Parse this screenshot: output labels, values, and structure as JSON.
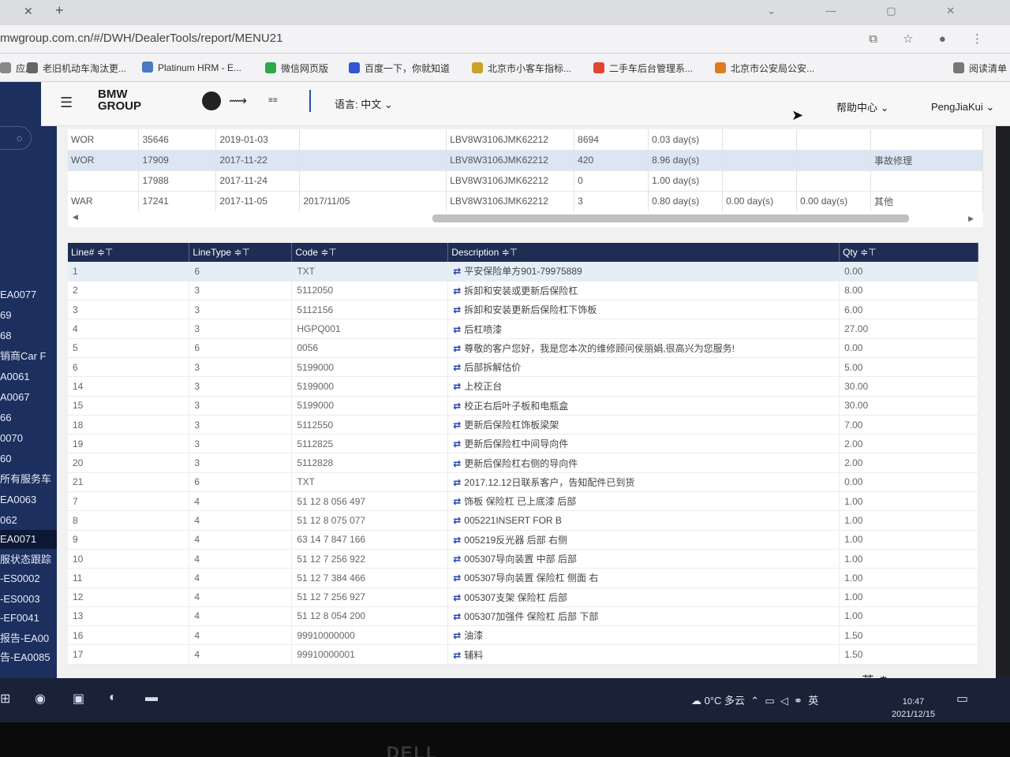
{
  "browser": {
    "url": "mwgroup.com.cn/#/DWH/DealerTools/report/MENU21",
    "bookmarks": [
      "应用",
      "老旧机动车淘汰更...",
      "Platinum HRM - E...",
      "微信网页版",
      "百度一下，你就知道",
      "北京市小客车指标...",
      "二手车后台管理系...",
      "北京市公安局公安...",
      "阅读清单"
    ]
  },
  "header": {
    "logo_line1": "BMW",
    "logo_line2": "GROUP",
    "language": "语言: 中文",
    "help": "帮助中心",
    "user": "PengJiaKui"
  },
  "sidebar": {
    "items": [
      "EA0077",
      "69",
      "68",
      "销商Car F",
      "A0061",
      "A0067",
      "66",
      "0070",
      "60",
      "所有服务车",
      "EA0063",
      "062",
      "EA0071",
      "服状态跟踪",
      "-ES0002",
      "-ES0003",
      "-EF0041",
      "报告-EA00",
      "告-EA0085"
    ],
    "active_index": 12
  },
  "top_table": {
    "rows": [
      [
        "WOR",
        "35646",
        "2019-01-03",
        "",
        "LBV8W3106JMK62212",
        "8694",
        "0.03 day(s)",
        "",
        "",
        ""
      ],
      [
        "WOR",
        "17909",
        "2017-11-22",
        "",
        "LBV8W3106JMK62212",
        "420",
        "8.96 day(s)",
        "",
        "",
        "事故修理"
      ],
      [
        "",
        "17988",
        "2017-11-24",
        "",
        "LBV8W3106JMK62212",
        "0",
        "1.00 day(s)",
        "",
        "",
        ""
      ],
      [
        "WAR",
        "17241",
        "2017-11-05",
        "2017/11/05",
        "LBV8W3106JMK62212",
        "3",
        "0.80 day(s)",
        "0.00 day(s)",
        "0.00 day(s)",
        "其他"
      ]
    ],
    "selected_row": 1
  },
  "lines_table": {
    "columns": [
      "Line# ≑⊤",
      "LineType ≑⊤",
      "Code ≑⊤",
      "Description ≑⊤",
      "Qty ≑⊤"
    ],
    "rows": [
      [
        "1",
        "6",
        "TXT",
        "平安保险单方901-79975889",
        "0.00"
      ],
      [
        "2",
        "3",
        "5112050",
        "拆卸和安装或更新后保险杠",
        "8.00"
      ],
      [
        "3",
        "3",
        "5112156",
        "拆卸和安装更新后保险杠下饰板",
        "6.00"
      ],
      [
        "4",
        "3",
        "HGPQ001",
        "后杠喷漆",
        "27.00"
      ],
      [
        "5",
        "6",
        "0056",
        "尊敬的客户您好，我是您本次的维修顾问侯丽娟,很高兴为您服务!",
        "0.00"
      ],
      [
        "6",
        "3",
        "5199000",
        "后部拆解估价",
        "5.00"
      ],
      [
        "14",
        "3",
        "5199000",
        "上校正台",
        "30.00"
      ],
      [
        "15",
        "3",
        "5199000",
        "校正右后叶子板和电瓶盒",
        "30.00"
      ],
      [
        "18",
        "3",
        "5112550",
        "更新后保险杠饰板梁架",
        "7.00"
      ],
      [
        "19",
        "3",
        "5112825",
        "更新后保险杠中间导向件",
        "2.00"
      ],
      [
        "20",
        "3",
        "5112828",
        "更新后保险杠右侧的导向件",
        "2.00"
      ],
      [
        "21",
        "6",
        "TXT",
        "2017.12.12日联系客户，告知配件已到货",
        "0.00"
      ],
      [
        "7",
        "4",
        "51 12 8 056 497",
        "饰板 保险杠 已上底漆 后部",
        "1.00"
      ],
      [
        "8",
        "4",
        "51 12 8 075 077",
        "005221INSERT FOR B",
        "1.00"
      ],
      [
        "9",
        "4",
        "63 14 7 847 166",
        "005219反光器 后部 右侧",
        "1.00"
      ],
      [
        "10",
        "4",
        "51 12 7 256 922",
        "005307导向装置 中部 后部",
        "1.00"
      ],
      [
        "11",
        "4",
        "51 12 7 384 466",
        "005307导向装置 保险杠 侧面 右",
        "1.00"
      ],
      [
        "12",
        "4",
        "51 12 7 256 927",
        "005307支架 保险杠 后部",
        "1.00"
      ],
      [
        "13",
        "4",
        "51 12 8 054 200",
        "005307加强件 保险杠 后部 下部",
        "1.00"
      ],
      [
        "16",
        "4",
        "99910000000",
        "油漆",
        "1.50"
      ],
      [
        "17",
        "4",
        "99910000001",
        "辅料",
        "1.50"
      ]
    ]
  },
  "status": {
    "ime": "英",
    "weather": "0°C 多云",
    "ime_tray": "英",
    "time": "10:47",
    "date": "2021/12/15"
  },
  "monitor_brand": "DELL"
}
